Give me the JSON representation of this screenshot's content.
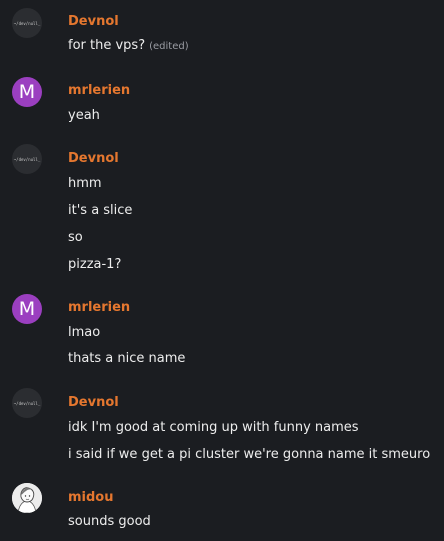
{
  "groups": [
    {
      "author": "Devnol",
      "avatar": {
        "type": "devnol",
        "text": "~/dev/null_"
      },
      "messages": [
        {
          "text": "for the vps?",
          "edited": "(edited)"
        }
      ]
    },
    {
      "author": "mrlerien",
      "avatar": {
        "type": "letter",
        "letter": "M",
        "color": "#9b3fc0"
      },
      "messages": [
        {
          "text": "yeah"
        }
      ]
    },
    {
      "author": "Devnol",
      "avatar": {
        "type": "devnol",
        "text": "~/dev/null_"
      },
      "messages": [
        {
          "text": "hmm"
        },
        {
          "text": "it's a slice"
        },
        {
          "text": "so"
        },
        {
          "text": "pizza-1?"
        }
      ]
    },
    {
      "author": "mrlerien",
      "avatar": {
        "type": "letter",
        "letter": "M",
        "color": "#9b3fc0"
      },
      "messages": [
        {
          "text": "lmao"
        },
        {
          "text": "thats a nice name"
        }
      ]
    },
    {
      "author": "Devnol",
      "avatar": {
        "type": "devnol",
        "text": "~/dev/null_"
      },
      "messages": [
        {
          "text": "idk I'm good at coming up with funny names"
        },
        {
          "text": "i said if we get a pi cluster we're gonna name it smeuro"
        }
      ]
    },
    {
      "author": "midou",
      "avatar": {
        "type": "illustration"
      },
      "messages": [
        {
          "text": "sounds good"
        }
      ]
    }
  ],
  "colors": {
    "background": "#1b1d21",
    "username": "#e5772f",
    "message_text": "#ededed",
    "edited_text": "#9a9ca3"
  }
}
